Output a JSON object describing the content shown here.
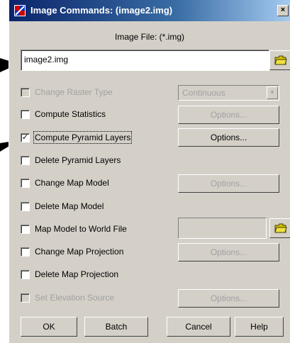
{
  "window": {
    "title": "Image Commands: (image2.img)",
    "close_glyph": "×"
  },
  "file": {
    "label": "Image File: (*.img)",
    "value": "image2.img"
  },
  "raster_type": {
    "label": "Change Raster Type",
    "selected": "Continuous"
  },
  "options": {
    "compute_statistics": {
      "label": "Compute Statistics",
      "button": "Options..."
    },
    "compute_pyramid": {
      "label": "Compute Pyramid Layers",
      "button": "Options...",
      "checked_glyph": "✓"
    },
    "delete_pyramid": {
      "label": "Delete Pyramid Layers"
    },
    "change_map_model": {
      "label": "Change Map Model",
      "button": "Options..."
    },
    "delete_map_model": {
      "label": "Delete Map Model"
    },
    "map_model_world": {
      "label": "Map Model to World File"
    },
    "change_projection": {
      "label": "Change Map Projection",
      "button": "Options..."
    },
    "delete_projection": {
      "label": "Delete Map Projection"
    },
    "set_elevation": {
      "label": "Set Elevation Source",
      "button": "Options..."
    }
  },
  "buttons": {
    "ok": "OK",
    "batch": "Batch",
    "cancel": "Cancel",
    "help": "Help"
  },
  "colors": {
    "title_start": "#0a246a",
    "title_end": "#a6caf0",
    "dialog_bg": "#d4d0c8",
    "disabled_text": "#a0a0a0",
    "folder": "#d8c000"
  }
}
